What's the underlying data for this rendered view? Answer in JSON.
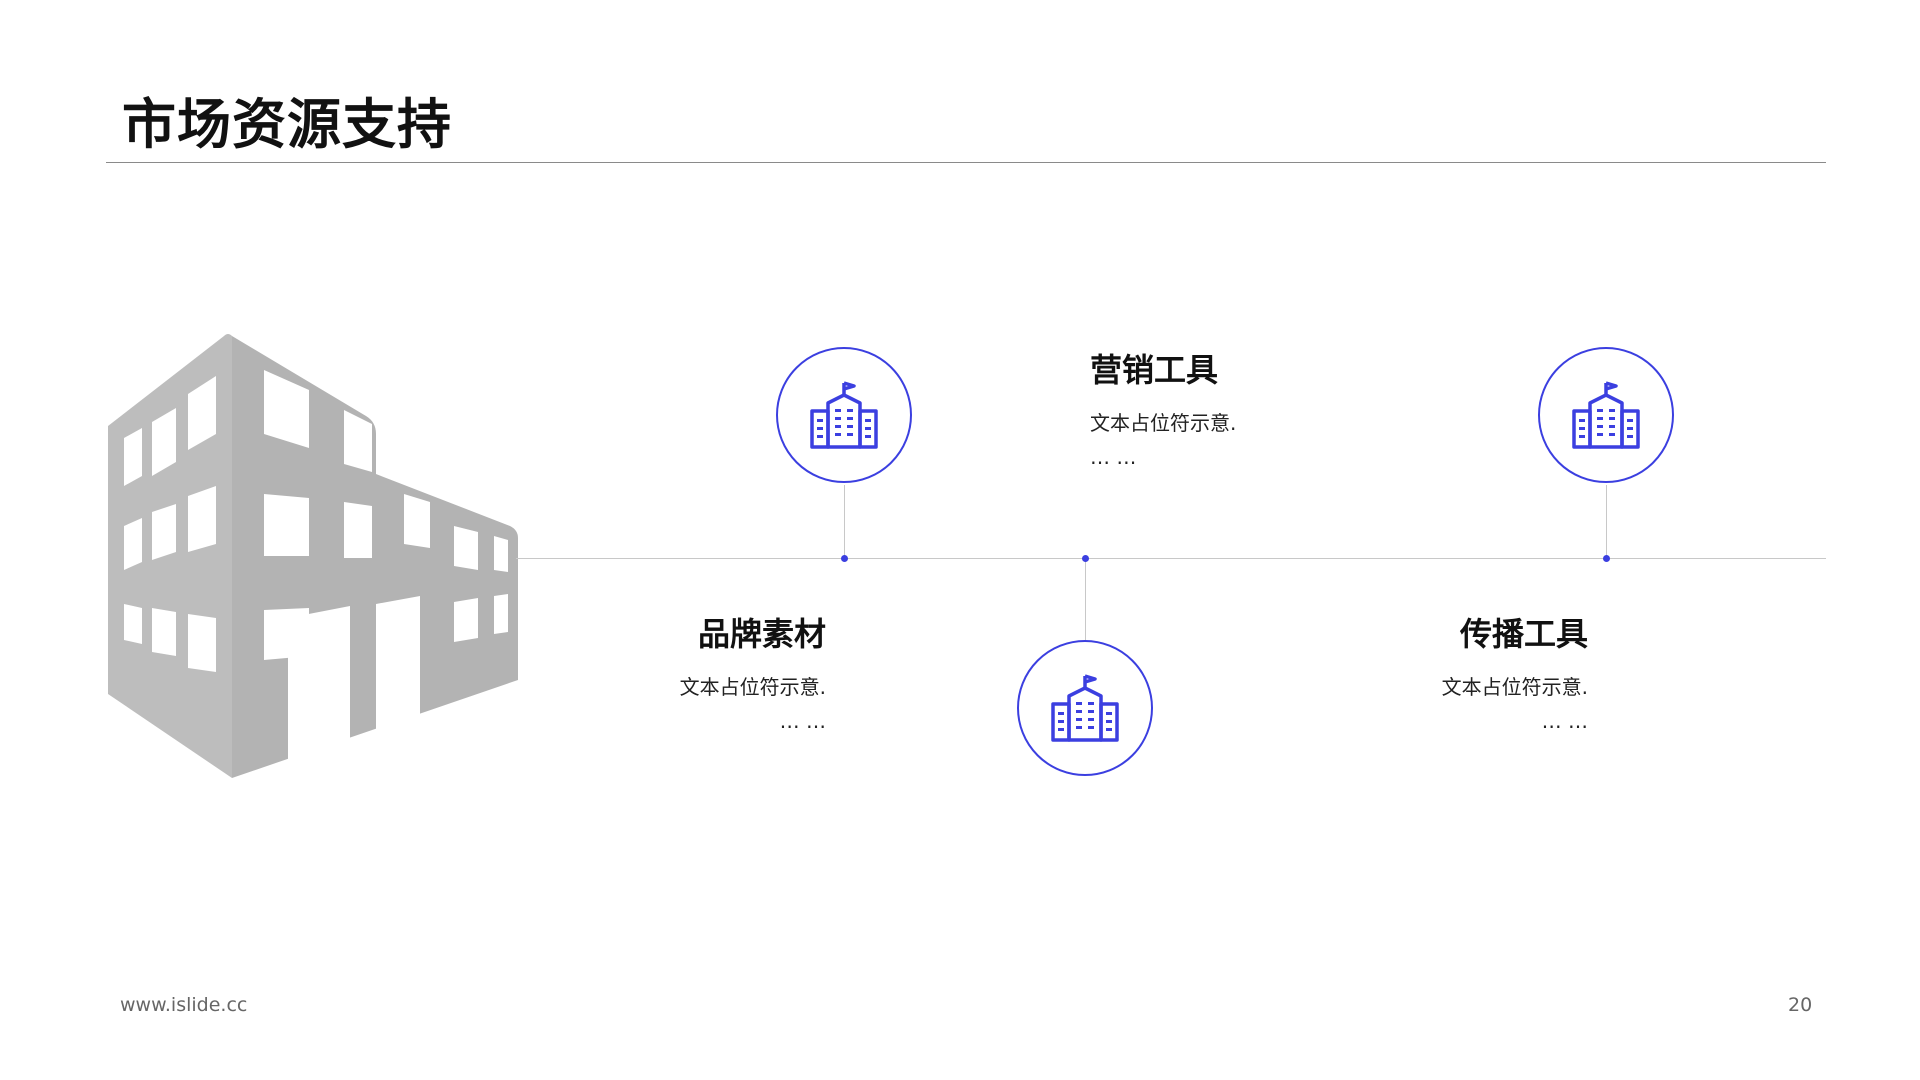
{
  "slide": {
    "title": "市场资源支持"
  },
  "accent_color": "#3b3fe0",
  "building_color": "#bcbcbc",
  "items": [
    {
      "title": "品牌素材",
      "desc_line1": "文本占位符示意.",
      "desc_line2": "… …",
      "icon": "building-icon"
    },
    {
      "title": "营销工具",
      "desc_line1": "文本占位符示意.",
      "desc_line2": "… …",
      "icon": "building-icon"
    },
    {
      "title": "传播工具",
      "desc_line1": "文本占位符示意.",
      "desc_line2": "… …",
      "icon": "building-icon"
    }
  ],
  "footer": {
    "url": "www.islide.cc",
    "page": "20"
  }
}
